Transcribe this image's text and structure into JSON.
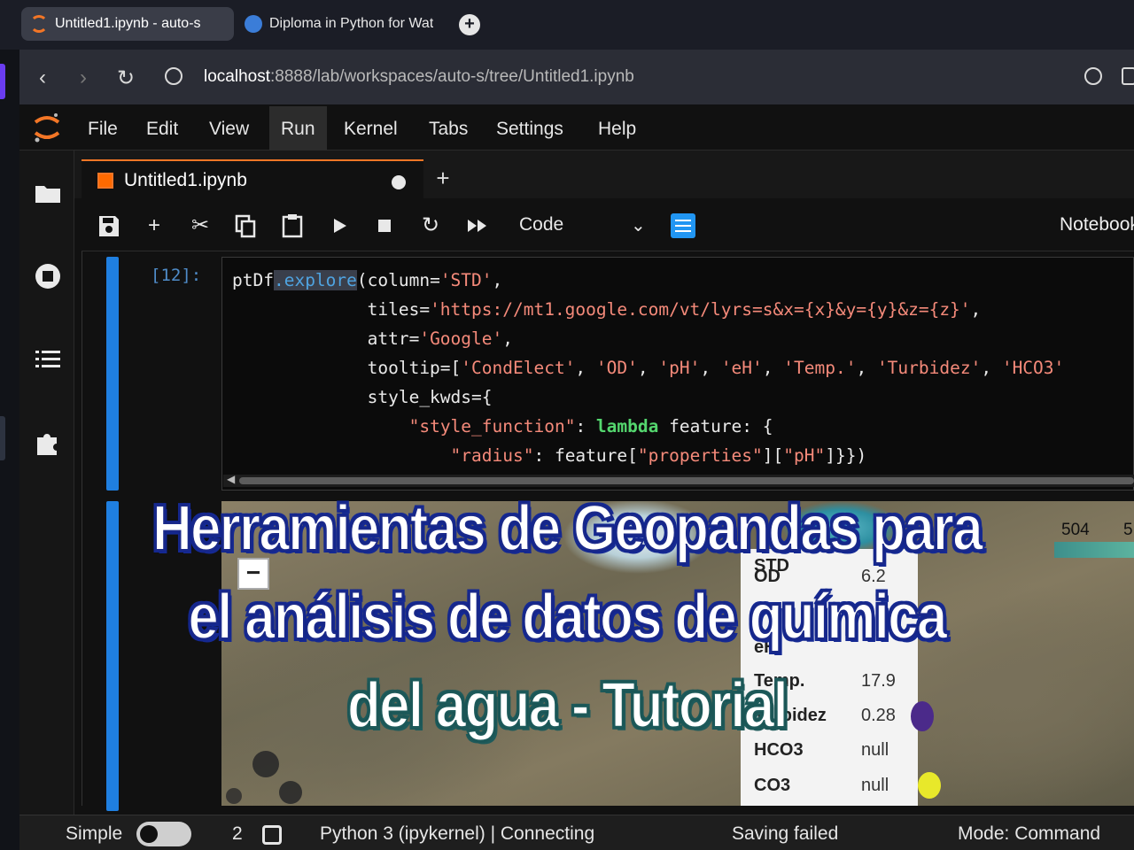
{
  "browser": {
    "tabs": [
      {
        "title": "Untitled1.ipynb - auto-s",
        "active": true
      },
      {
        "title": "Diploma in Python for Wat",
        "active": false
      }
    ],
    "new_tab": "+",
    "url_host": "localhost",
    "url_rest": ":8888/lab/workspaces/auto-s/tree/Untitled1.ipynb",
    "icons": [
      "back-arrow-icon",
      "forward-arrow-icon",
      "reload-icon",
      "globe-icon",
      "zoom-icon"
    ]
  },
  "menu": {
    "items": [
      "File",
      "Edit",
      "View",
      "Run",
      "Kernel",
      "Tabs",
      "Settings",
      "Help"
    ],
    "active": "Run"
  },
  "doc_tab": {
    "title": "Untitled1.ipynb",
    "add": "+"
  },
  "toolbar": {
    "cell_type": "Code",
    "kernel_label": "Notebook",
    "icons": [
      "save-icon",
      "add-cell-icon",
      "cut-icon",
      "copy-icon",
      "paste-icon",
      "run-icon",
      "stop-icon",
      "restart-icon",
      "fast-forward-icon",
      "property-inspector-icon"
    ]
  },
  "cell": {
    "prompt": "[12]:",
    "code": {
      "line1_a": "ptDf",
      "line1_b": ".explore",
      "line1_c": "(column=",
      "line1_d": "'STD'",
      "line1_e": ",",
      "line2_a": "             tiles=",
      "line2_b": "'https://mt1.google.com/vt/lyrs=s&x={x}&y={y}&z={z}'",
      "line2_c": ",",
      "line3_a": "             attr=",
      "line3_b": "'Google'",
      "line3_c": ",",
      "line4_a": "             tooltip=[",
      "line4_b": "'CondElect'",
      "line4_c": ", ",
      "line4_d": "'OD'",
      "line4_e": ", ",
      "line4_f": "'pH'",
      "line4_g": ", ",
      "line4_h": "'eH'",
      "line4_i": ", ",
      "line4_j": "'Temp.'",
      "line4_k": ", ",
      "line4_l": "'Turbidez'",
      "line4_m": ", ",
      "line4_n": "'HCO3'",
      "line5_a": "             style_kwds={",
      "line6_a": "                 ",
      "line6_b": "\"style_function\"",
      "line6_c": ": ",
      "line6_d": "lambda",
      "line6_e": " feature: {",
      "line7_a": "                     ",
      "line7_b": "\"radius\"",
      "line7_c": ": feature[",
      "line7_d": "\"properties\"",
      "line7_e": "][",
      "line7_f": "\"pH\"",
      "line7_g": "]}})"
    }
  },
  "map": {
    "zoom_minus": "−",
    "legend_ticks": [
      "504",
      "5"
    ],
    "popup": [
      {
        "key": "STD",
        "value": ""
      },
      {
        "key": "OD",
        "value": "6.2"
      },
      {
        "key": "eH",
        "value": ""
      },
      {
        "key": "Temp.",
        "value": "17.9"
      },
      {
        "key": "Turbidez",
        "value": "0.28"
      },
      {
        "key": "HCO3",
        "value": "null"
      },
      {
        "key": "CO3",
        "value": "null"
      }
    ]
  },
  "overlay": {
    "line1": "Herramientas de Geopandas para",
    "line2": "el análisis de datos de química",
    "line3": "del agua - Tutorial",
    "colors": {
      "text": "#ffffff",
      "outline1": "#162a94",
      "outline2": "#1f5c5c"
    }
  },
  "status": {
    "mode_label": "Simple",
    "count": "2",
    "kernel": "Python 3 (ipykernel) | Connecting",
    "save": "Saving failed",
    "mode": "Mode: Command"
  },
  "colors": {
    "accent": "#f37626",
    "collapser": "#1f7fe0",
    "prompt": "#4f8cc9"
  }
}
